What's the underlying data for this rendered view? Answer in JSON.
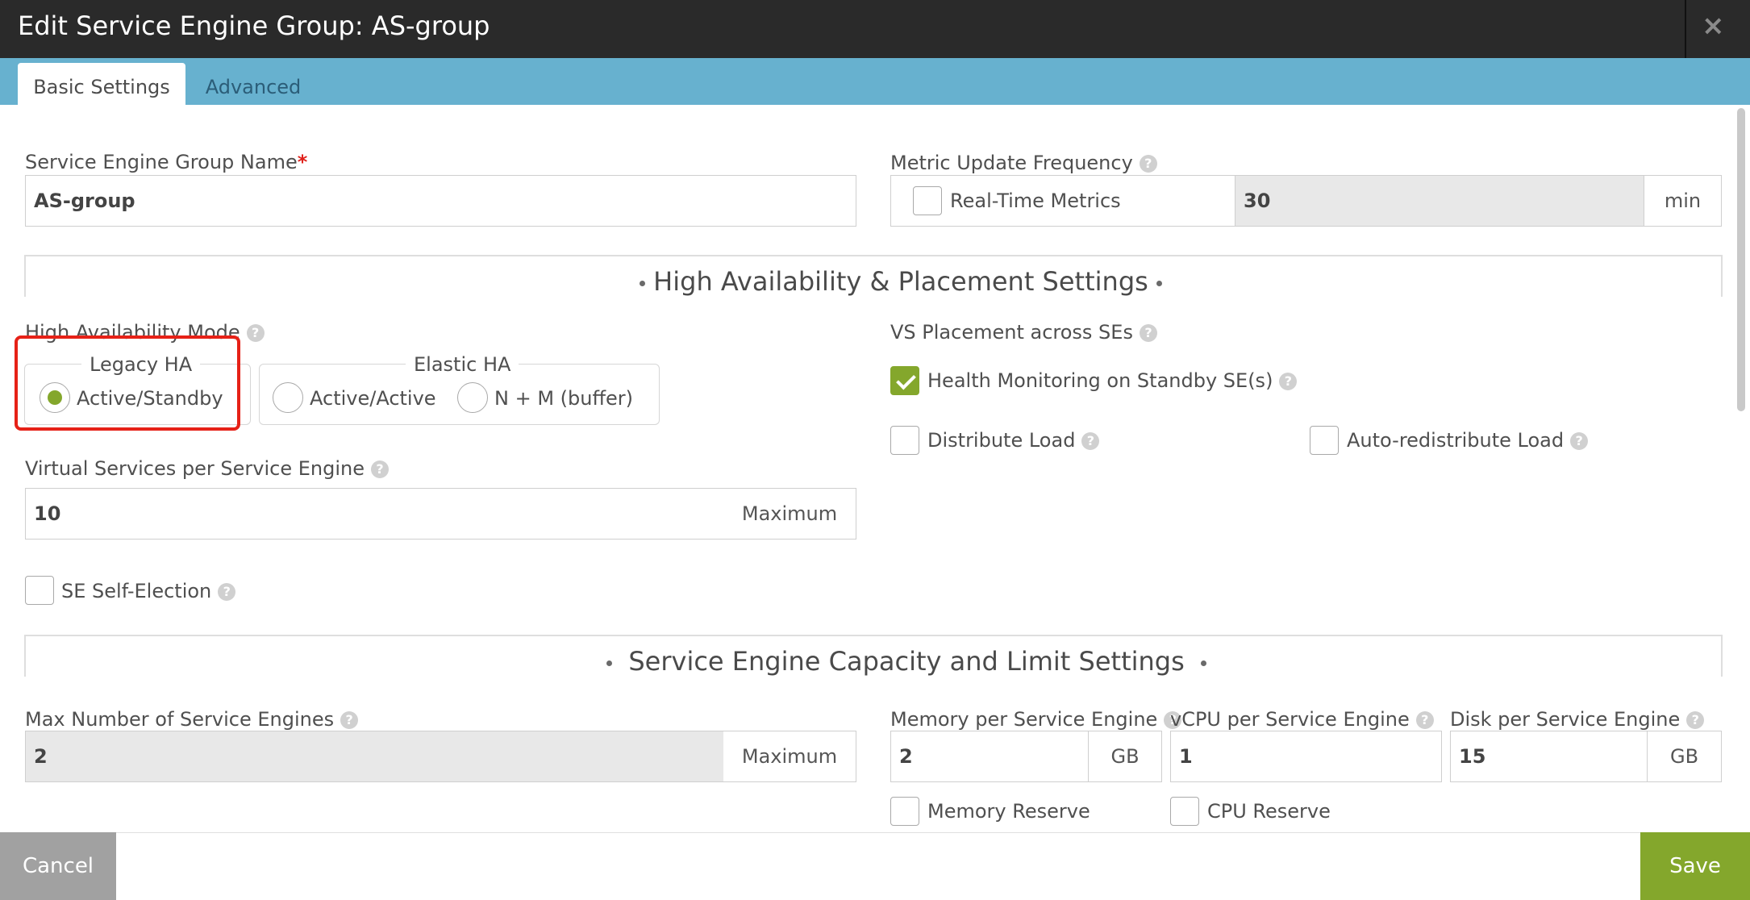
{
  "header": {
    "title": "Edit Service Engine Group: AS-group",
    "close_glyph": "×"
  },
  "tabs": [
    {
      "label": "Basic Settings",
      "active": true
    },
    {
      "label": "Advanced",
      "active": false
    }
  ],
  "fields": {
    "group_name": {
      "label": "Service Engine Group Name",
      "required_mark": "*",
      "value": "AS-group"
    },
    "metric_update": {
      "label": "Metric Update Frequency",
      "realtime_label": "Real-Time Metrics",
      "realtime_checked": false,
      "value": "30",
      "unit": "min"
    }
  },
  "sections": {
    "ha": {
      "title": "High Availability & Placement Settings"
    },
    "capacity": {
      "title": "Service Engine Capacity and Limit Settings"
    }
  },
  "ha_mode": {
    "label": "High Availability Mode",
    "legacy_group": "Legacy HA",
    "elastic_group": "Elastic HA",
    "options": [
      {
        "label": "Active/Standby",
        "selected": true
      },
      {
        "label": "Active/Active",
        "selected": false
      },
      {
        "label": "N + M (buffer)",
        "selected": false
      }
    ]
  },
  "vs_per_se": {
    "label": "Virtual Services per Service Engine",
    "value": "10",
    "addon": "Maximum"
  },
  "se_self_election": {
    "label": "SE Self-Election",
    "checked": false
  },
  "vs_placement": {
    "label": "VS Placement across SEs",
    "health_monitoring": {
      "label": "Health Monitoring on Standby SE(s)",
      "checked": true
    },
    "distribute_load": {
      "label": "Distribute Load",
      "checked": false
    },
    "auto_redistribute": {
      "label": "Auto-redistribute Load",
      "checked": false
    }
  },
  "capacity": {
    "max_se": {
      "label": "Max Number of Service Engines",
      "value": "2",
      "addon": "Maximum"
    },
    "memory": {
      "label": "Memory per Service Engine",
      "value": "2",
      "unit": "GB"
    },
    "vcpu": {
      "label": "vCPU per Service Engine",
      "value": "1"
    },
    "disk": {
      "label": "Disk per Service Engine",
      "value": "15",
      "unit": "GB"
    },
    "memory_reserve": {
      "label": "Memory Reserve",
      "checked": false
    },
    "cpu_reserve": {
      "label": "CPU Reserve",
      "checked": false
    }
  },
  "footer": {
    "cancel": "Cancel",
    "save": "Save"
  },
  "icons": {
    "help": "help-circle-icon",
    "check": "checkmark-icon",
    "close": "close-icon"
  },
  "colors": {
    "accent_green": "#84a72c",
    "tab_bar": "#67b1cf",
    "header": "#2a2a2a",
    "highlight": "#e62117"
  }
}
